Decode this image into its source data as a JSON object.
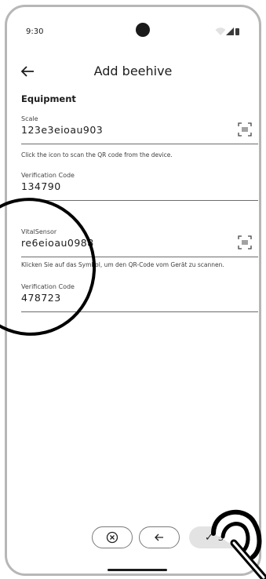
{
  "status_bar": {
    "time": "9:30"
  },
  "app_bar": {
    "title": "Add beehive"
  },
  "equipment": {
    "section_title": "Equipment",
    "scale": {
      "label": "Scale",
      "value": "123e3eioau903",
      "helper": "Click the icon to scan the QR code from the device."
    },
    "scale_verification": {
      "label": "Verification Code",
      "value": "134790"
    },
    "vital_sensor": {
      "label": "VitalSensor",
      "value": "re6eioau0988",
      "helper": "Klicken Sie auf das Symbol, um den QR-Code vom Gerät zu scannen."
    },
    "vital_verification": {
      "label": "Verification Code",
      "value": "478723"
    }
  },
  "bottom_actions": {
    "save_label": "Save",
    "cancel_icon": "cancel-circle-icon",
    "back_icon": "arrow-left-icon",
    "save_icon": "check-icon"
  },
  "colors": {
    "underline": "#6d6d6d",
    "save_bg": "#e3e3e3"
  }
}
